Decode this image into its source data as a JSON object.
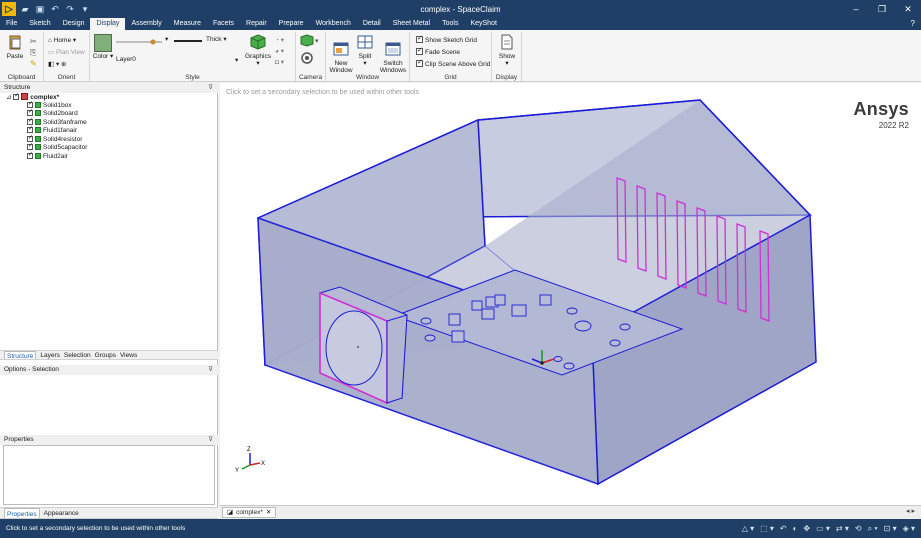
{
  "window": {
    "title": "complex - SpaceClaim",
    "app_logo": "▷",
    "qat_icons": [
      "open-icon",
      "save-icon",
      "undo-icon",
      "redo-icon",
      "customize-icon"
    ],
    "controls": [
      "–",
      "❐",
      "✕"
    ]
  },
  "menu": {
    "tabs": [
      "File",
      "Sketch",
      "Design",
      "Display",
      "Assembly",
      "Measure",
      "Facets",
      "Repair",
      "Prepare",
      "Workbench",
      "Detail",
      "Sheet Metal",
      "Tools",
      "KeyShot"
    ],
    "active": "Display",
    "help": "?"
  },
  "ribbon": {
    "clipboard": {
      "label": "Clipboard",
      "paste": "Paste"
    },
    "orient": {
      "label": "Orient",
      "home": "Home",
      "plan_view": "Plan View"
    },
    "style": {
      "label": "Style",
      "color": "Color",
      "layer": "Layer0",
      "line_weight": "Thick"
    },
    "graphics": {
      "label": "Graphics"
    },
    "camera": {
      "label": "Camera"
    },
    "window": {
      "label": "Window",
      "new_window": "New\nWindow",
      "split": "Split",
      "switch_windows": "Switch\nWindows"
    },
    "grid": {
      "label": "Grid",
      "show_sketch_grid": "Show Sketch Grid",
      "fade_scene": "Fade Scene",
      "clip_scene": "Clip Scene Above Grid"
    },
    "display": {
      "label": "Display",
      "show": "Show"
    }
  },
  "structure": {
    "header": "Structure",
    "root": "complex*",
    "items": [
      "Solid1box",
      "Solid2board",
      "Solid3fanframe",
      "Fluid1fanair",
      "Solid4resistor",
      "Solid5capacitor",
      "Fluid2air"
    ]
  },
  "panel_tabs": [
    "Structure",
    "Layers",
    "Selection",
    "Groups",
    "Views"
  ],
  "options_header": "Options - Selection",
  "properties_header": "Properties",
  "bottom_tabs": [
    "Properties",
    "Appearance"
  ],
  "viewport": {
    "hint": "Click to set a secondary selection to be used within other tools",
    "brand": "Ansys",
    "version": "2022 R2",
    "axis_labels": {
      "x": "X",
      "y": "Y",
      "z": "Z"
    }
  },
  "doc_tab": "complex*",
  "status": "Click to set a secondary selection to be used within other tools",
  "colors": {
    "accent": "#1f3f66",
    "box_edge": "#1c1cd6",
    "box_fill": "#aab0cf",
    "fan_edge": "#d22fd2"
  }
}
